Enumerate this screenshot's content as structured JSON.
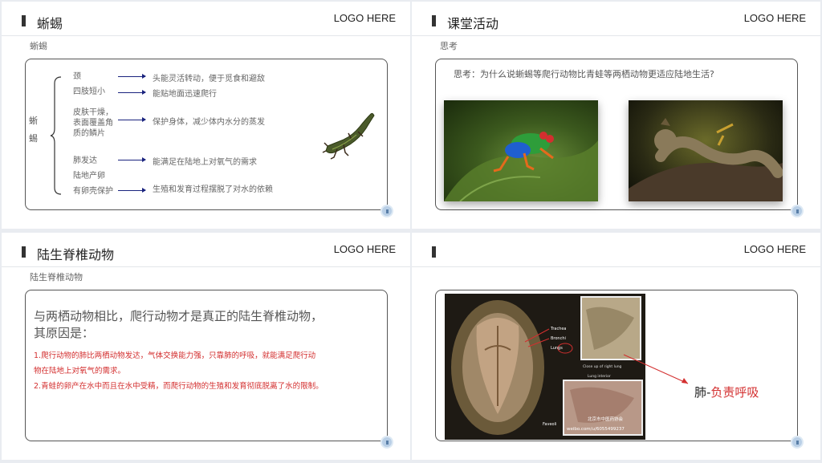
{
  "logo_text": "LOGO HERE",
  "slide1": {
    "title": "蜥蜴",
    "subtitle": "蜥蜴",
    "root_label": "蜥\n蜴",
    "items": [
      {
        "label": "颈",
        "desc": "头能灵活转动，便于觅食和避敌"
      },
      {
        "label": "四肢短小",
        "desc": "能贴地面迅速爬行"
      },
      {
        "label": "皮肤干燥，\n表面覆盖角\n质的鳞片",
        "desc": "保护身体，减少体内水分的蒸发"
      },
      {
        "label": "肺发达",
        "desc": "能满足在陆地上对氧气的需求"
      },
      {
        "label": "陆地产卵",
        "desc": ""
      },
      {
        "label": "有卵壳保护",
        "desc": "生殖和发育过程摆脱了对水的依赖"
      }
    ]
  },
  "slide2": {
    "title": "课堂活动",
    "subtitle": "思考",
    "question": "思考：为什么说蜥蜴等爬行动物比青蛙等两栖动物更适应陆地生活?",
    "images": [
      "frog-photo",
      "lizard-photo"
    ]
  },
  "slide3": {
    "title": "陆生脊椎动物",
    "subtitle": "陆生脊椎动物",
    "lead": "与两栖动物相比，爬行动物才是真正的陆生脊椎动物，\n其原因是：",
    "points": [
      "1.爬行动物的肺比两栖动物发达，气体交换能力强，只靠肺的呼吸，就能满足爬行动\n物在陆地上对氧气的需求。",
      "2.青蛙的卵产在水中而且在水中受精，而爬行动物的生殖和发育彻底脱离了水的限制。"
    ]
  },
  "slide4": {
    "title": "",
    "label_prefix": "肺-",
    "label_red": "负责呼吸",
    "photo_labels": {
      "trachea": "Trachea",
      "bronchi": "Bronchi",
      "lungs": "Lungs",
      "closeup": "Close up of right lung",
      "interior": "Lung interior",
      "faveoli": "Faveoli",
      "watermark": "北京市中医药协会",
      "url": "weibo.com/u/6055499237"
    }
  },
  "colors": {
    "arrow": "#1a237e",
    "red": "#d32f2f"
  }
}
